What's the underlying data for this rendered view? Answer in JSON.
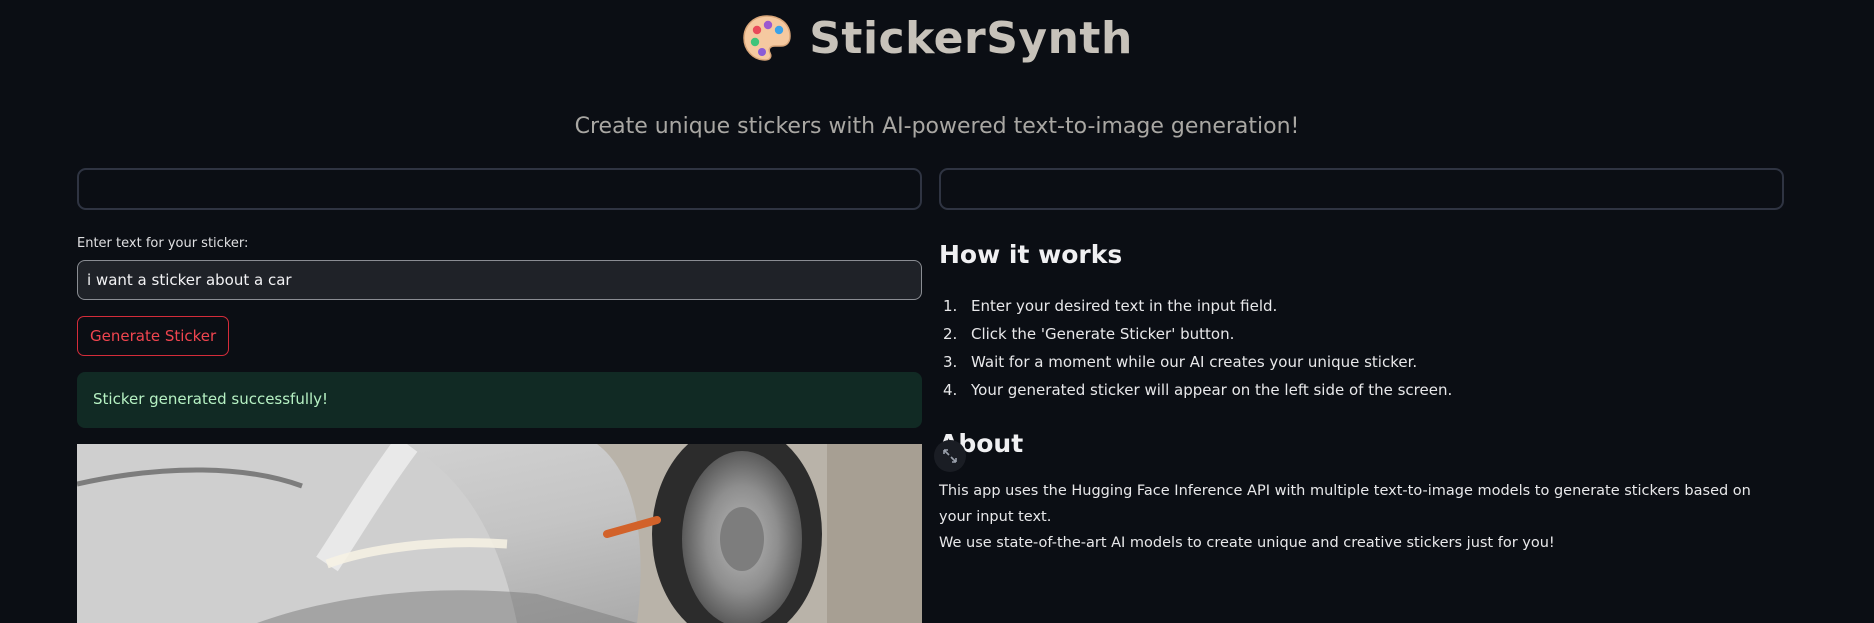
{
  "header": {
    "title": "StickerSynth",
    "icon": "palette-icon",
    "subtitle": "Create unique stickers with AI-powered text-to-image generation!"
  },
  "form": {
    "label": "Enter text for your sticker:",
    "input_value": "i want a sticker about a car",
    "button_label": "Generate Sticker",
    "success_message": "Sticker generated successfully!"
  },
  "result": {
    "image": "car-sticker-image",
    "expand_icon": "expand-icon"
  },
  "sidebar": {
    "how_title": "How it works",
    "steps": [
      {
        "num": "1.",
        "text": "Enter your desired text in the input field."
      },
      {
        "num": "2.",
        "text": "Click the 'Generate Sticker' button."
      },
      {
        "num": "3.",
        "text": "Wait for a moment while our AI creates your unique sticker."
      },
      {
        "num": "4.",
        "text": "Your generated sticker will appear on the left side of the screen."
      }
    ],
    "about_title": "About",
    "about_lines": [
      "This app uses the Hugging Face Inference API with multiple text-to-image models to generate stickers based on your input text.",
      "We use state-of-the-art AI models to create unique and creative stickers just for you!"
    ]
  },
  "colors": {
    "background": "#0b0e14",
    "accent_red": "#f0454f",
    "success_bg": "#112a24",
    "success_text": "#b6f1c3"
  }
}
